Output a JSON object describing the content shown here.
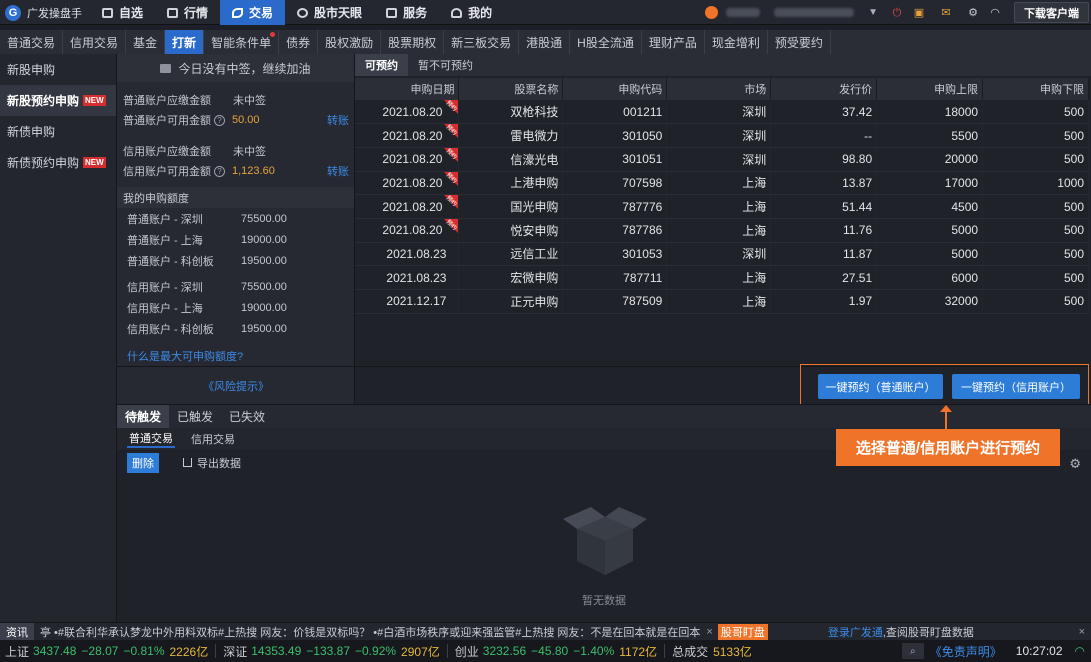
{
  "top": {
    "app": "广发操盘手",
    "nav": [
      {
        "label": "自选"
      },
      {
        "label": "行情"
      },
      {
        "label": "交易"
      },
      {
        "label": "股市天眼"
      },
      {
        "label": "服务"
      },
      {
        "label": "我的"
      }
    ],
    "download": "下载客户端"
  },
  "subtabs": [
    "普通交易",
    "信用交易",
    "基金",
    "打新",
    "智能条件单",
    "债券",
    "股权激励",
    "股票期权",
    "新三板交易",
    "港股通",
    "H股全流通",
    "理财产品",
    "现金增利",
    "预受要约"
  ],
  "leftnav": [
    {
      "label": "新股申购",
      "badge": ""
    },
    {
      "label": "新股预约申购",
      "badge": "NEW"
    },
    {
      "label": "新债申购",
      "badge": ""
    },
    {
      "label": "新债预约申购",
      "badge": "NEW"
    }
  ],
  "info": {
    "banner": "今日没有中签，继续加油",
    "normal_pay_label": "普通账户应缴金额",
    "normal_pay_value": "未中签",
    "normal_avail_label": "普通账户可用金额",
    "normal_avail_value": "50.00",
    "transfer": "转账",
    "credit_pay_label": "信用账户应缴金额",
    "credit_pay_value": "未中签",
    "credit_avail_label": "信用账户可用金额",
    "credit_avail_value": "1,123.60",
    "quota_title": "我的申购额度",
    "quotas": [
      {
        "a": "普通账户 - 深圳",
        "v": "75500.00"
      },
      {
        "a": "普通账户 - 上海",
        "v": "19000.00"
      },
      {
        "a": "普通账户 - 科创板",
        "v": "19500.00"
      },
      {
        "a": "信用账户 - 深圳",
        "v": "75500.00"
      },
      {
        "a": "信用账户 - 上海",
        "v": "19000.00"
      },
      {
        "a": "信用账户 - 科创板",
        "v": "19500.00"
      }
    ],
    "howlink": "什么是最大可申购额度?",
    "risk": "《风险提示》"
  },
  "main": {
    "tabs": [
      "可预约",
      "暂不可预约"
    ],
    "columns": [
      "申购日期",
      "股票名称",
      "申购代码",
      "市场",
      "发行价",
      "申购上限",
      "申购下限"
    ],
    "ribbon": "预约",
    "rows": [
      [
        "2021.08.20",
        "双枪科技",
        "001211",
        "深圳",
        "37.42",
        "18000",
        "500"
      ],
      [
        "2021.08.20",
        "雷电微力",
        "301050",
        "深圳",
        "--",
        "5500",
        "500"
      ],
      [
        "2021.08.20",
        "信濠光电",
        "301051",
        "深圳",
        "98.80",
        "20000",
        "500"
      ],
      [
        "2021.08.20",
        "上港申购",
        "707598",
        "上海",
        "13.87",
        "17000",
        "1000"
      ],
      [
        "2021.08.20",
        "国光申购",
        "787776",
        "上海",
        "51.44",
        "4500",
        "500"
      ],
      [
        "2021.08.20",
        "悦安申购",
        "787786",
        "上海",
        "11.76",
        "5000",
        "500"
      ],
      [
        "2021.08.23",
        "远信工业",
        "301053",
        "深圳",
        "11.87",
        "5000",
        "500"
      ],
      [
        "2021.08.23",
        "宏微申购",
        "787711",
        "上海",
        "27.51",
        "6000",
        "500"
      ],
      [
        "2021.12.17",
        "正元申购",
        "787509",
        "上海",
        "1.97",
        "32000",
        "500"
      ]
    ],
    "btn_normal": "一键预约（普通账户）",
    "btn_credit": "一键预约（信用账户）"
  },
  "callout": "选择普通/信用账户进行预约",
  "bottom": {
    "tabs": [
      "待触发",
      "已触发",
      "已失效"
    ],
    "subtabs": [
      "普通交易",
      "信用交易"
    ],
    "delete": "删除",
    "export": "导出数据",
    "empty": "暂无数据"
  },
  "news": {
    "label": "资讯",
    "text": "亭   •#联合利华承认梦龙中外用料双标#上热搜 网友：价钱是双标吗？    •#白酒市场秩序或迎来强监管#上热搜 网友：不是在回本就是在回本",
    "tag": "股哥盯盘",
    "link": "登录广发通",
    "link_tail": ",查阅股哥盯盘数据"
  },
  "status": {
    "sh_label": "上证",
    "sh": "3437.48",
    "sh_chg": "−28.07",
    "sh_pct": "−0.81%",
    "sh_amt": "2226亿",
    "sz_label": "深证",
    "sz": "14353.49",
    "sz_chg": "−133.87",
    "sz_pct": "−0.92%",
    "sz_amt": "2907亿",
    "cy_label": "创业",
    "cy": "3232.56",
    "cy_chg": "−45.80",
    "cy_pct": "−1.40%",
    "cy_amt": "1172亿",
    "total_label": "总成交",
    "total": "5133亿",
    "disclaimer": "《免责声明》",
    "time": "10:27:02"
  }
}
